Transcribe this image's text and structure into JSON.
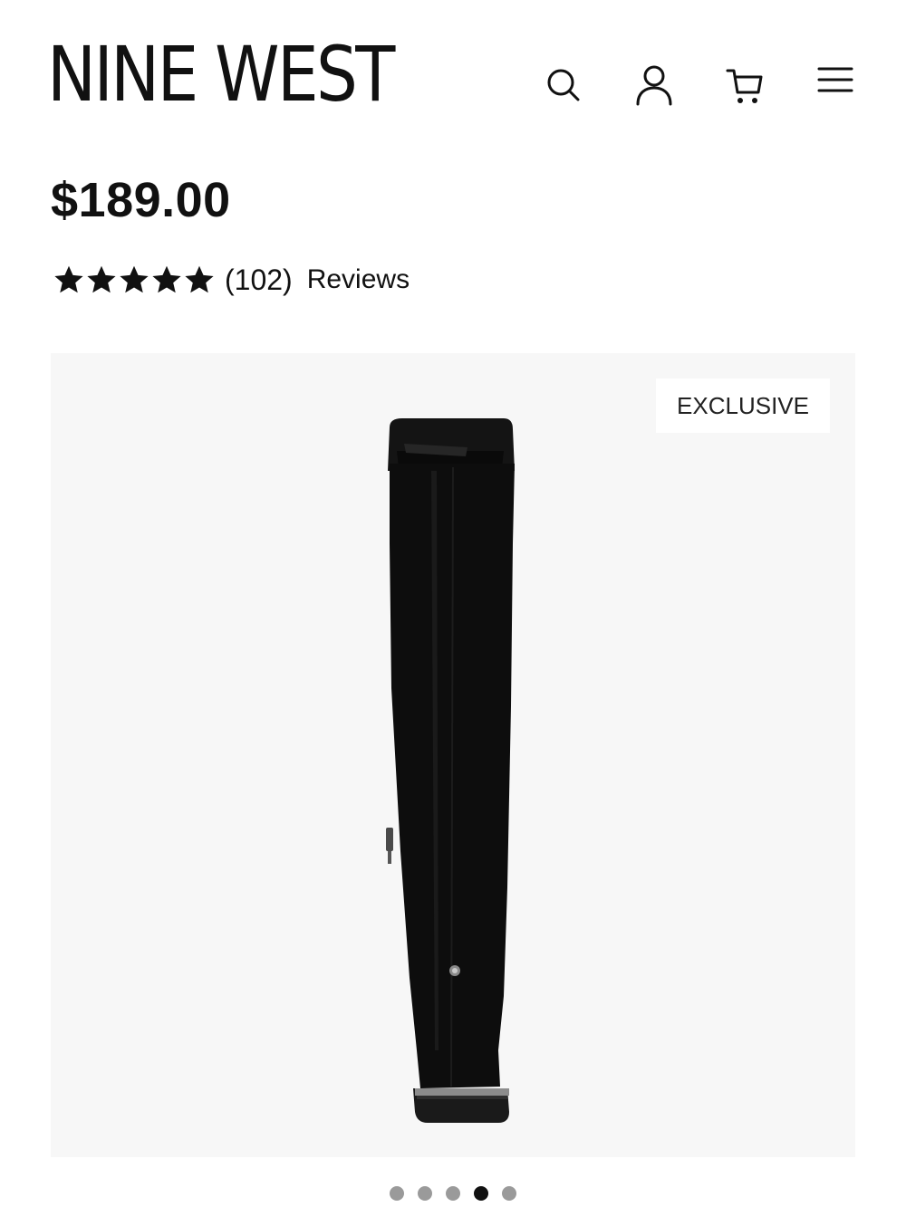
{
  "header": {
    "brand": "NINE WEST",
    "icons": [
      "search-icon",
      "account-icon",
      "cart-icon",
      "menu-icon"
    ]
  },
  "product": {
    "price": "$189.00",
    "rating_value": 5,
    "rating_max": 5,
    "review_count": "(102)",
    "reviews_label": "Reviews",
    "badge": "EXCLUSIVE"
  },
  "gallery": {
    "image_count": 5,
    "active_index": 3
  },
  "colors": {
    "text": "#111111",
    "gallery_bg": "#f7f7f7",
    "dot_inactive": "#9a9a9a",
    "dot_active": "#111111"
  }
}
